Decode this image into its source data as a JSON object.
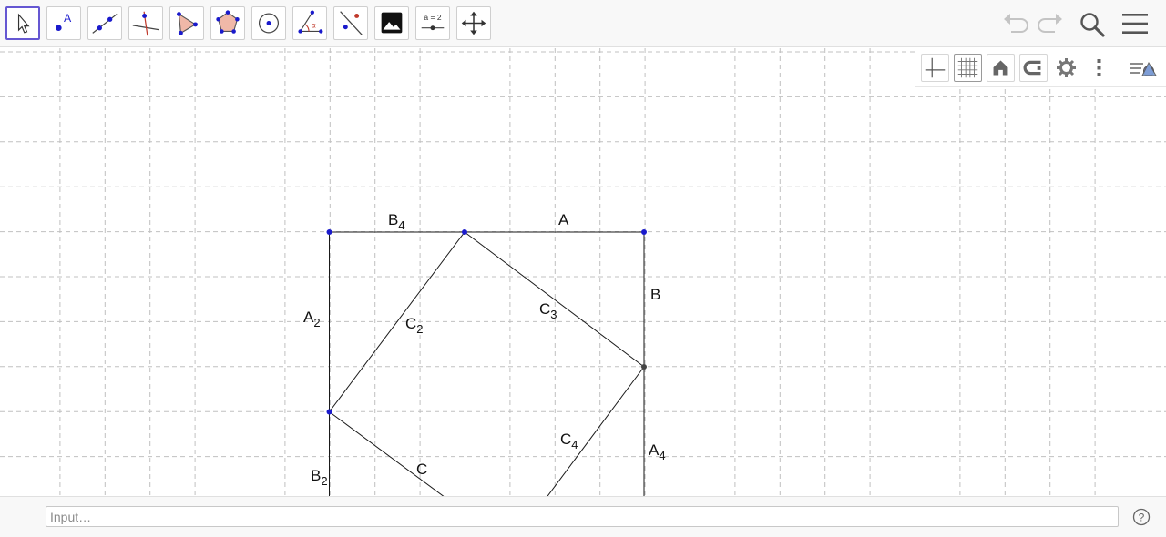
{
  "toolbar": {
    "tools": [
      {
        "name": "move-tool",
        "label": ""
      },
      {
        "name": "point-tool",
        "label": "A"
      },
      {
        "name": "line-tool",
        "label": ""
      },
      {
        "name": "perpendicular-line-tool",
        "label": ""
      },
      {
        "name": "polygon-tool",
        "label": ""
      },
      {
        "name": "regular-polygon-tool",
        "label": ""
      },
      {
        "name": "circle-tool",
        "label": ""
      },
      {
        "name": "angle-tool",
        "label": "α"
      },
      {
        "name": "reflect-tool",
        "label": ""
      },
      {
        "name": "image-tool",
        "label": ""
      },
      {
        "name": "slider-tool",
        "label": "a = 2"
      },
      {
        "name": "move-graphics-view-tool",
        "label": ""
      }
    ],
    "selected_tool": "move-tool",
    "right_icons": [
      "undo-icon",
      "redo-icon",
      "search-icon",
      "menu-icon"
    ]
  },
  "style_bar": {
    "buttons": [
      "axes-icon",
      "grid-icon",
      "home-icon",
      "point-capturing-icon",
      "settings-icon",
      "more-icon",
      "toggle-style-bar-icon"
    ],
    "active": "grid-icon"
  },
  "geometry": {
    "segment_labels": {
      "a": "A",
      "b": "B",
      "c": "C",
      "a2": "A",
      "a2_sub": "2",
      "a4": "A",
      "a4_sub": "4",
      "b2": "B",
      "b2_sub": "2",
      "b4": "B",
      "b4_sub": "4",
      "c2": "C",
      "c2_sub": "2",
      "c3": "C",
      "c3_sub": "3",
      "c4": "C",
      "c4_sub": "4"
    },
    "colors": {
      "point": "#1a1acc",
      "segment": "#1a1a1a",
      "grid": "#c0c0c0",
      "accent": "#6557d2"
    }
  },
  "input_bar": {
    "placeholder": "Input…"
  }
}
